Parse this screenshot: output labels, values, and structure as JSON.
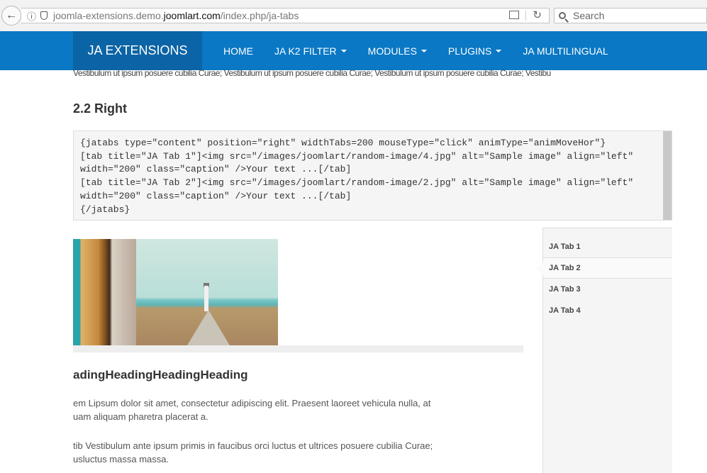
{
  "browser": {
    "url_prefix": "joomla-extensions.demo.",
    "url_domain": "joomlart.com",
    "url_path": "/index.php/ja-tabs",
    "search_placeholder": "Search"
  },
  "site": {
    "brand": "JA EXTENSIONS",
    "nav": [
      {
        "label": "HOME",
        "dropdown": false
      },
      {
        "label": "JA K2 FILTER",
        "dropdown": true
      },
      {
        "label": "MODULES",
        "dropdown": true
      },
      {
        "label": "PLUGINS",
        "dropdown": true
      },
      {
        "label": "JA MULTILINGUAL",
        "dropdown": false
      }
    ]
  },
  "content": {
    "overlap_text": "Vestibulum ut ipsum posuere cubilia Curae; Vestibulum ut ipsum posuere cubilia Curae; Vestibulum ut ipsum posuere cubilia Curae; Vestibu",
    "section_heading": "2.2 Right",
    "code_lines": [
      "{jatabs type=\"content\" position=\"right\" widthTabs=200 mouseType=\"click\" animType=\"animMoveHor\"}",
      "[tab title=\"JA Tab 1\"]<img src=\"/images/joomlart/random-image/4.jpg\" alt=\"Sample image\" align=\"left\"",
      "width=\"200\" class=\"caption\" />Your text ...[/tab]",
      "[tab title=\"JA Tab 2\"]<img src=\"/images/joomlart/random-image/2.jpg\" alt=\"Sample image\" align=\"left\"",
      "width=\"200\" class=\"caption\" />Your text ...[/tab]",
      "{/jatabs}"
    ],
    "tabs": [
      "JA Tab 1",
      "JA Tab 2",
      "JA Tab 3",
      "JA Tab 4"
    ],
    "active_tab": "JA Tab 2",
    "heading2": "adingHeadingHeadingHeading",
    "para1_line1": "em Lipsum dolor sit amet, consectetur adipiscing elit. Praesent laoreet vehicula nulla, at",
    "para1_line2": "uam aliquam pharetra placerat a.",
    "para2_line1": "tib Vestibulum ante ipsum primis in faucibus orci luctus et ultrices posuere cubilia Curae;",
    "para2_line2": "usluctus massa massa."
  },
  "colors": {
    "header": "#0a78c5",
    "brand_bg": "#0b64a5"
  }
}
